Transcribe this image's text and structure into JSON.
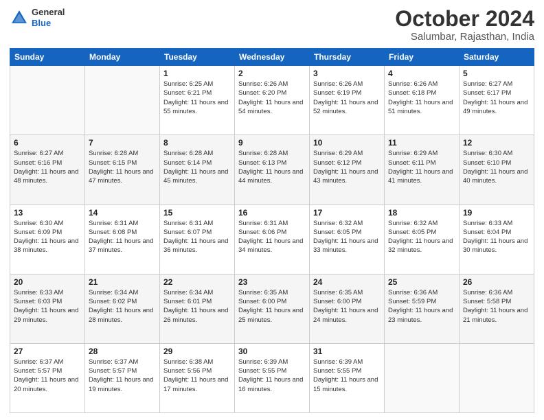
{
  "logo": {
    "line1": "General",
    "line2": "Blue"
  },
  "title": {
    "month_year": "October 2024",
    "location": "Salumbar, Rajasthan, India"
  },
  "headers": [
    "Sunday",
    "Monday",
    "Tuesday",
    "Wednesday",
    "Thursday",
    "Friday",
    "Saturday"
  ],
  "weeks": [
    [
      {
        "day": "",
        "sunrise": "",
        "sunset": "",
        "daylight": ""
      },
      {
        "day": "",
        "sunrise": "",
        "sunset": "",
        "daylight": ""
      },
      {
        "day": "1",
        "sunrise": "Sunrise: 6:25 AM",
        "sunset": "Sunset: 6:21 PM",
        "daylight": "Daylight: 11 hours and 55 minutes."
      },
      {
        "day": "2",
        "sunrise": "Sunrise: 6:26 AM",
        "sunset": "Sunset: 6:20 PM",
        "daylight": "Daylight: 11 hours and 54 minutes."
      },
      {
        "day": "3",
        "sunrise": "Sunrise: 6:26 AM",
        "sunset": "Sunset: 6:19 PM",
        "daylight": "Daylight: 11 hours and 52 minutes."
      },
      {
        "day": "4",
        "sunrise": "Sunrise: 6:26 AM",
        "sunset": "Sunset: 6:18 PM",
        "daylight": "Daylight: 11 hours and 51 minutes."
      },
      {
        "day": "5",
        "sunrise": "Sunrise: 6:27 AM",
        "sunset": "Sunset: 6:17 PM",
        "daylight": "Daylight: 11 hours and 49 minutes."
      }
    ],
    [
      {
        "day": "6",
        "sunrise": "Sunrise: 6:27 AM",
        "sunset": "Sunset: 6:16 PM",
        "daylight": "Daylight: 11 hours and 48 minutes."
      },
      {
        "day": "7",
        "sunrise": "Sunrise: 6:28 AM",
        "sunset": "Sunset: 6:15 PM",
        "daylight": "Daylight: 11 hours and 47 minutes."
      },
      {
        "day": "8",
        "sunrise": "Sunrise: 6:28 AM",
        "sunset": "Sunset: 6:14 PM",
        "daylight": "Daylight: 11 hours and 45 minutes."
      },
      {
        "day": "9",
        "sunrise": "Sunrise: 6:28 AM",
        "sunset": "Sunset: 6:13 PM",
        "daylight": "Daylight: 11 hours and 44 minutes."
      },
      {
        "day": "10",
        "sunrise": "Sunrise: 6:29 AM",
        "sunset": "Sunset: 6:12 PM",
        "daylight": "Daylight: 11 hours and 43 minutes."
      },
      {
        "day": "11",
        "sunrise": "Sunrise: 6:29 AM",
        "sunset": "Sunset: 6:11 PM",
        "daylight": "Daylight: 11 hours and 41 minutes."
      },
      {
        "day": "12",
        "sunrise": "Sunrise: 6:30 AM",
        "sunset": "Sunset: 6:10 PM",
        "daylight": "Daylight: 11 hours and 40 minutes."
      }
    ],
    [
      {
        "day": "13",
        "sunrise": "Sunrise: 6:30 AM",
        "sunset": "Sunset: 6:09 PM",
        "daylight": "Daylight: 11 hours and 38 minutes."
      },
      {
        "day": "14",
        "sunrise": "Sunrise: 6:31 AM",
        "sunset": "Sunset: 6:08 PM",
        "daylight": "Daylight: 11 hours and 37 minutes."
      },
      {
        "day": "15",
        "sunrise": "Sunrise: 6:31 AM",
        "sunset": "Sunset: 6:07 PM",
        "daylight": "Daylight: 11 hours and 36 minutes."
      },
      {
        "day": "16",
        "sunrise": "Sunrise: 6:31 AM",
        "sunset": "Sunset: 6:06 PM",
        "daylight": "Daylight: 11 hours and 34 minutes."
      },
      {
        "day": "17",
        "sunrise": "Sunrise: 6:32 AM",
        "sunset": "Sunset: 6:05 PM",
        "daylight": "Daylight: 11 hours and 33 minutes."
      },
      {
        "day": "18",
        "sunrise": "Sunrise: 6:32 AM",
        "sunset": "Sunset: 6:05 PM",
        "daylight": "Daylight: 11 hours and 32 minutes."
      },
      {
        "day": "19",
        "sunrise": "Sunrise: 6:33 AM",
        "sunset": "Sunset: 6:04 PM",
        "daylight": "Daylight: 11 hours and 30 minutes."
      }
    ],
    [
      {
        "day": "20",
        "sunrise": "Sunrise: 6:33 AM",
        "sunset": "Sunset: 6:03 PM",
        "daylight": "Daylight: 11 hours and 29 minutes."
      },
      {
        "day": "21",
        "sunrise": "Sunrise: 6:34 AM",
        "sunset": "Sunset: 6:02 PM",
        "daylight": "Daylight: 11 hours and 28 minutes."
      },
      {
        "day": "22",
        "sunrise": "Sunrise: 6:34 AM",
        "sunset": "Sunset: 6:01 PM",
        "daylight": "Daylight: 11 hours and 26 minutes."
      },
      {
        "day": "23",
        "sunrise": "Sunrise: 6:35 AM",
        "sunset": "Sunset: 6:00 PM",
        "daylight": "Daylight: 11 hours and 25 minutes."
      },
      {
        "day": "24",
        "sunrise": "Sunrise: 6:35 AM",
        "sunset": "Sunset: 6:00 PM",
        "daylight": "Daylight: 11 hours and 24 minutes."
      },
      {
        "day": "25",
        "sunrise": "Sunrise: 6:36 AM",
        "sunset": "Sunset: 5:59 PM",
        "daylight": "Daylight: 11 hours and 23 minutes."
      },
      {
        "day": "26",
        "sunrise": "Sunrise: 6:36 AM",
        "sunset": "Sunset: 5:58 PM",
        "daylight": "Daylight: 11 hours and 21 minutes."
      }
    ],
    [
      {
        "day": "27",
        "sunrise": "Sunrise: 6:37 AM",
        "sunset": "Sunset: 5:57 PM",
        "daylight": "Daylight: 11 hours and 20 minutes."
      },
      {
        "day": "28",
        "sunrise": "Sunrise: 6:37 AM",
        "sunset": "Sunset: 5:57 PM",
        "daylight": "Daylight: 11 hours and 19 minutes."
      },
      {
        "day": "29",
        "sunrise": "Sunrise: 6:38 AM",
        "sunset": "Sunset: 5:56 PM",
        "daylight": "Daylight: 11 hours and 17 minutes."
      },
      {
        "day": "30",
        "sunrise": "Sunrise: 6:39 AM",
        "sunset": "Sunset: 5:55 PM",
        "daylight": "Daylight: 11 hours and 16 minutes."
      },
      {
        "day": "31",
        "sunrise": "Sunrise: 6:39 AM",
        "sunset": "Sunset: 5:55 PM",
        "daylight": "Daylight: 11 hours and 15 minutes."
      },
      {
        "day": "",
        "sunrise": "",
        "sunset": "",
        "daylight": ""
      },
      {
        "day": "",
        "sunrise": "",
        "sunset": "",
        "daylight": ""
      }
    ]
  ]
}
